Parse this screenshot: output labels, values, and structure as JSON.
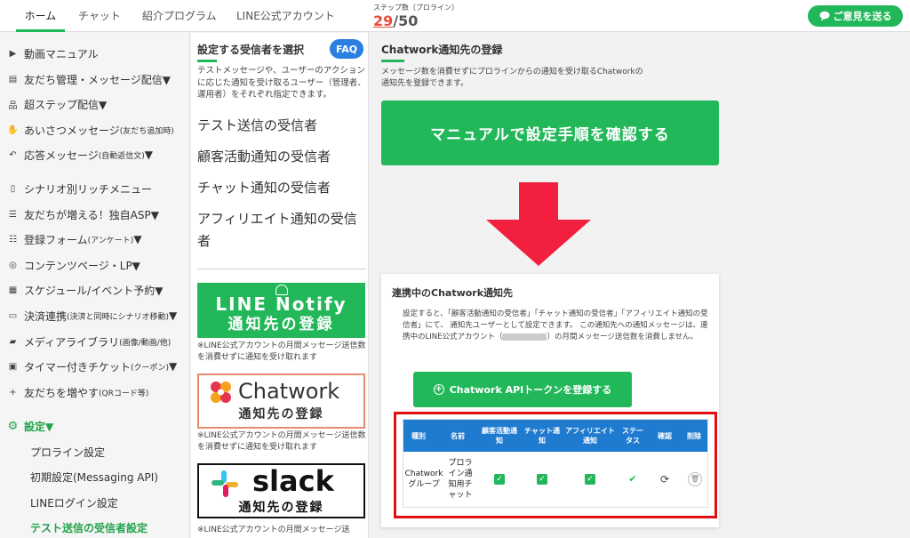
{
  "header": {
    "tabs": [
      {
        "label": "ホーム",
        "active": true
      },
      {
        "label": "チャット"
      },
      {
        "label": "紹介プログラム"
      },
      {
        "label": "LINE公式アカウント"
      }
    ],
    "step_label": "ステップ数（プロライン）",
    "step_current": "29",
    "step_total": "/50",
    "feedback_label": "ご意見を送る"
  },
  "sidebar": {
    "items": [
      {
        "label": "動画マニュアル",
        "icon": "video-icon"
      },
      {
        "label": "友だち管理・メッセージ配信▼",
        "icon": "contact-book-icon"
      },
      {
        "label": "超ステップ配信▼",
        "icon": "sitemap-icon"
      },
      {
        "label": "あいさつメッセージ",
        "small": "(友だち追加時)",
        "icon": "hand-icon"
      },
      {
        "label": "応答メッセージ",
        "small": "(自動返信文)",
        "suffix": "▼",
        "icon": "reply-icon"
      },
      {
        "label": "シナリオ別リッチメニュー",
        "icon": "mobile-icon"
      },
      {
        "label": "友だちが増える！独自ASP▼",
        "icon": "handshake-icon"
      },
      {
        "label": "登録フォーム",
        "small": "(アンケート)",
        "suffix": "▼",
        "icon": "list-icon"
      },
      {
        "label": "コンテンツページ・LP▼",
        "icon": "globe-icon"
      },
      {
        "label": "スケジュール/イベント予約▼",
        "icon": "calendar-icon"
      },
      {
        "label": "決済連携",
        "small": "(決済と同時にシナリオ移動)",
        "suffix": "▼",
        "icon": "credit-card-icon"
      },
      {
        "label": "メディアライブラリ",
        "small": "(画像/動画/他)",
        "icon": "folder-icon"
      },
      {
        "label": "タイマー付きチケット",
        "small": "(クーポン)",
        "suffix": "▼",
        "icon": "ticket-icon"
      },
      {
        "label": "友だちを増やす",
        "small": "(QRコード等)",
        "icon": "user-plus-icon"
      }
    ],
    "settings_label": "設定▼",
    "sub_items": [
      {
        "label": "プロライン設定"
      },
      {
        "label": "初期設定(Messaging API)"
      },
      {
        "label": "LINEログイン設定"
      },
      {
        "label": "テスト送信の受信者設定",
        "active": true
      }
    ]
  },
  "middle": {
    "title": "設定する受信者を選択",
    "faq": "FAQ",
    "description": "テストメッセージや、ユーザーのアクションに応じた通知を受け取るユーザー（管理者、運用者）をそれぞれ指定できます。",
    "links": [
      "テスト送信の受信者",
      "顧客活動通知の受信者",
      "チャット通知の受信者",
      "アフィリエイト通知の受信者"
    ],
    "line_banner": {
      "line1": "LINE Notify",
      "line2": "通知先の登録"
    },
    "chatwork_banner": {
      "line1": "Chatwork",
      "line2": "通知先の登録"
    },
    "slack_banner": {
      "line1": "slack",
      "line2": "通知先の登録"
    },
    "banner_note": "※LINE公式アカウントの月間メッセージ送信数を消費せずに通知を受け取れます",
    "banner_note_partial": "※LINE公式アカウントの月間メッセージ送"
  },
  "main": {
    "title": "Chatwork通知先の登録",
    "description": "メッセージ数を消費せずにプロラインからの通知を受け取るChatworkの通知先を登録できます。",
    "manual_button": "マニュアルで設定手順を確認する",
    "card": {
      "title": "連携中のChatwork通知先",
      "description_a": "設定すると、「顧客活動通知の受信者」「チャット通知の受信者」「アフィリエイト通知の受信者」にて、 通知先ユーザーとして設定できます。 この通知先への通知メッセージは、連携中のLINE公式アカウント（",
      "description_b": "）の月間メッセージ送信数を消費しません。",
      "api_button": "Chatwork APIトークンを登録する",
      "table": {
        "headers": [
          "種別",
          "名前",
          "顧客活動通知",
          "チャット通知",
          "アフィリエイト通知",
          "ステータス",
          "確認",
          "削除"
        ],
        "rows": [
          {
            "type": "Chatworkグループ",
            "name": "プロライン通知用チャット",
            "customer": true,
            "chat": true,
            "affiliate": true,
            "status": "active"
          }
        ]
      }
    }
  },
  "colors": {
    "brand_green": "#22b85a",
    "table_header_blue": "#1f7bd0",
    "highlight_red": "#e01010",
    "arrow_red": "#f2203e",
    "step_red": "#e74c3c"
  }
}
